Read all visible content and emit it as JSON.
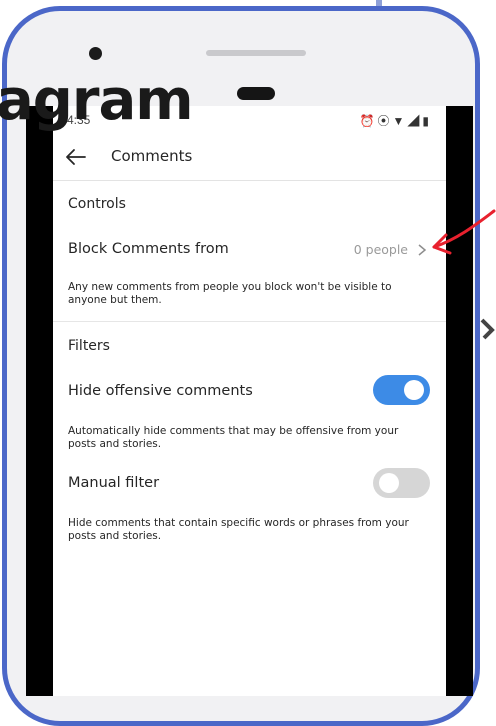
{
  "overlay": {
    "title_fragment": "agram"
  },
  "status_bar": {
    "time": "4:35",
    "left_icons": [
      "image-icon",
      "facebook-icon",
      "message-icon",
      "slack-icon",
      "dot-icon"
    ],
    "right_icons": [
      "alarm-icon",
      "vibrate-icon",
      "wifi-icon",
      "signal-icon",
      "battery-icon"
    ]
  },
  "app_bar": {
    "title": "Comments"
  },
  "controls": {
    "header": "Controls",
    "block_comments": {
      "label": "Block Comments from",
      "value": "0 people",
      "description": "Any new comments from people you block won't be visible to anyone but them."
    }
  },
  "filters": {
    "header": "Filters",
    "hide_offensive": {
      "label": "Hide offensive comments",
      "enabled": true,
      "description": "Automatically hide comments that may be offensive from your posts and stories."
    },
    "manual_filter": {
      "label": "Manual filter",
      "enabled": false,
      "description": "Hide comments that contain specific words or phrases from your posts and stories."
    }
  },
  "colors": {
    "phone_frame": "#4b67c8",
    "toggle_on": "#3d8be6",
    "toggle_off": "#d6d6d6",
    "annotation_arrow": "#e8212e"
  }
}
